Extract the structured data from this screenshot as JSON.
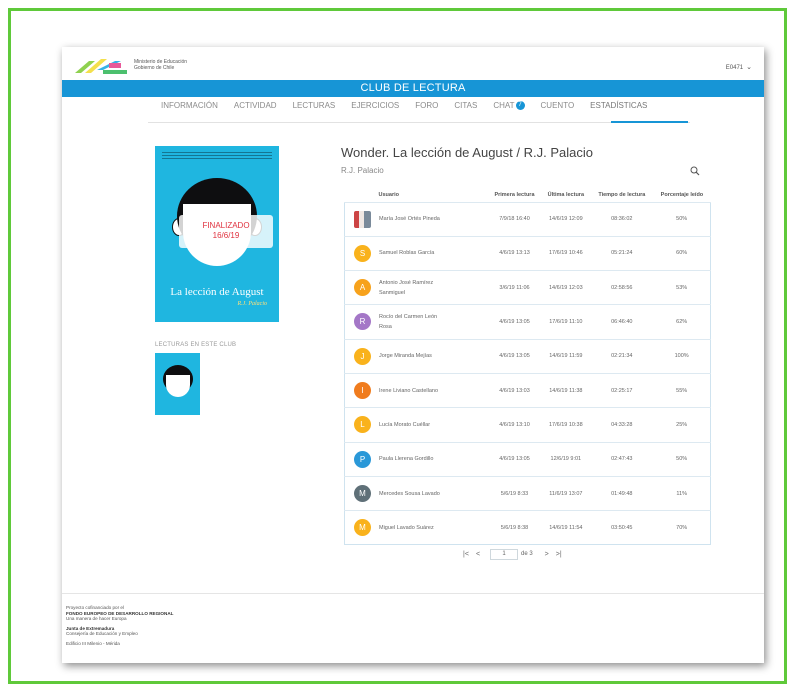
{
  "header": {
    "org_line1": "Ministerio de Educación",
    "org_line2": "Gobierno de Chile",
    "user": "E0471",
    "user_menu_icon": "chevron-down-icon"
  },
  "banner": {
    "title": "CLUB DE LECTURA",
    "color": "#1795d6"
  },
  "tabs": [
    {
      "label": "INFORMACIÓN"
    },
    {
      "label": "ACTIVIDAD"
    },
    {
      "label": "LECTURAS"
    },
    {
      "label": "EJERCICIOS"
    },
    {
      "label": "FORO"
    },
    {
      "label": "CITAS"
    },
    {
      "label": "CHAT",
      "badge": "7"
    },
    {
      "label": "CUENTO"
    },
    {
      "label": "ESTADÍSTICAS",
      "active": true
    }
  ],
  "book": {
    "cover_title": "La lección de August",
    "cover_author": "R.J. Palacio",
    "status_line1": "FINALIZADO",
    "status_line2": "16/6/19",
    "title": "Wonder. La lección de August / R.J. Palacio",
    "author": "R.J. Palacio"
  },
  "lecturas_label": "LECTURAS EN ESTE CLUB",
  "table": {
    "headers": [
      "Usuario",
      "Primera lectura",
      "Última lectura",
      "Tiempo de lectura",
      "Porcentaje leído"
    ],
    "rows": [
      {
        "initial": "",
        "color": "#ffffff",
        "photo": true,
        "name": "María José Ortés Pineda",
        "first": "7/9/18 16:40",
        "last": "14/6/19 12:09",
        "time": "08:36:02",
        "pct": "50%"
      },
      {
        "initial": "S",
        "color": "#f9b21c",
        "name": "Samuel Roblas García",
        "first": "4/6/19 13:13",
        "last": "17/6/19 10:46",
        "time": "05:21:24",
        "pct": "60%"
      },
      {
        "initial": "A",
        "color": "#f7a21c",
        "name": "Antonio José Ramírez Sanmiguel",
        "first": "3/6/19 11:06",
        "last": "14/6/19 12:03",
        "time": "02:58:56",
        "pct": "53%"
      },
      {
        "initial": "R",
        "color": "#a477c7",
        "name": "Rocío del Carmen León Rosa",
        "first": "4/6/19 13:05",
        "last": "17/6/19 11:10",
        "time": "06:46:40",
        "pct": "62%"
      },
      {
        "initial": "J",
        "color": "#f9b21c",
        "name": "Jorge Miranda Mejías",
        "first": "4/6/19 13:05",
        "last": "14/6/19 11:59",
        "time": "02:21:34",
        "pct": "100%"
      },
      {
        "initial": "I",
        "color": "#f07c1e",
        "name": "Irene Liviano Castellano",
        "first": "4/6/19 13:03",
        "last": "14/6/19 11:38",
        "time": "02:25:17",
        "pct": "55%"
      },
      {
        "initial": "L",
        "color": "#f9b21c",
        "name": "Lucía Morato Cuéllar",
        "first": "4/6/19 13:10",
        "last": "17/6/19 10:38",
        "time": "04:33:28",
        "pct": "25%"
      },
      {
        "initial": "P",
        "color": "#2a98d8",
        "name": "Paula Llerena Gordillo",
        "first": "4/6/19 13:05",
        "last": "12/6/19 9:01",
        "time": "02:47:43",
        "pct": "50%"
      },
      {
        "initial": "M",
        "color": "#5f7078",
        "name": "Mercedes Sousa Lavado",
        "first": "5/6/19 8:33",
        "last": "11/6/19 13:07",
        "time": "01:49:48",
        "pct": "11%"
      },
      {
        "initial": "M",
        "color": "#f9b21c",
        "name": "Miguel Lavado Suárez",
        "first": "5/6/19 8:38",
        "last": "14/6/19 11:54",
        "time": "03:50:45",
        "pct": "70%"
      }
    ]
  },
  "pager": {
    "first": "|<",
    "prev": "<",
    "current": "1",
    "of": "de 3",
    "next": ">",
    "last": ">|"
  },
  "footer": {
    "line1": "Proyecto cofinanciado por el",
    "line2": "FONDO EUROPEO DE DESARROLLO REGIONAL",
    "line3": "Una manera de hacer Europa",
    "line4": "Junta de Extremadura",
    "line5": "Consejería de Educación y Empleo",
    "line6": "Edificio III Milenio - Mérida"
  }
}
